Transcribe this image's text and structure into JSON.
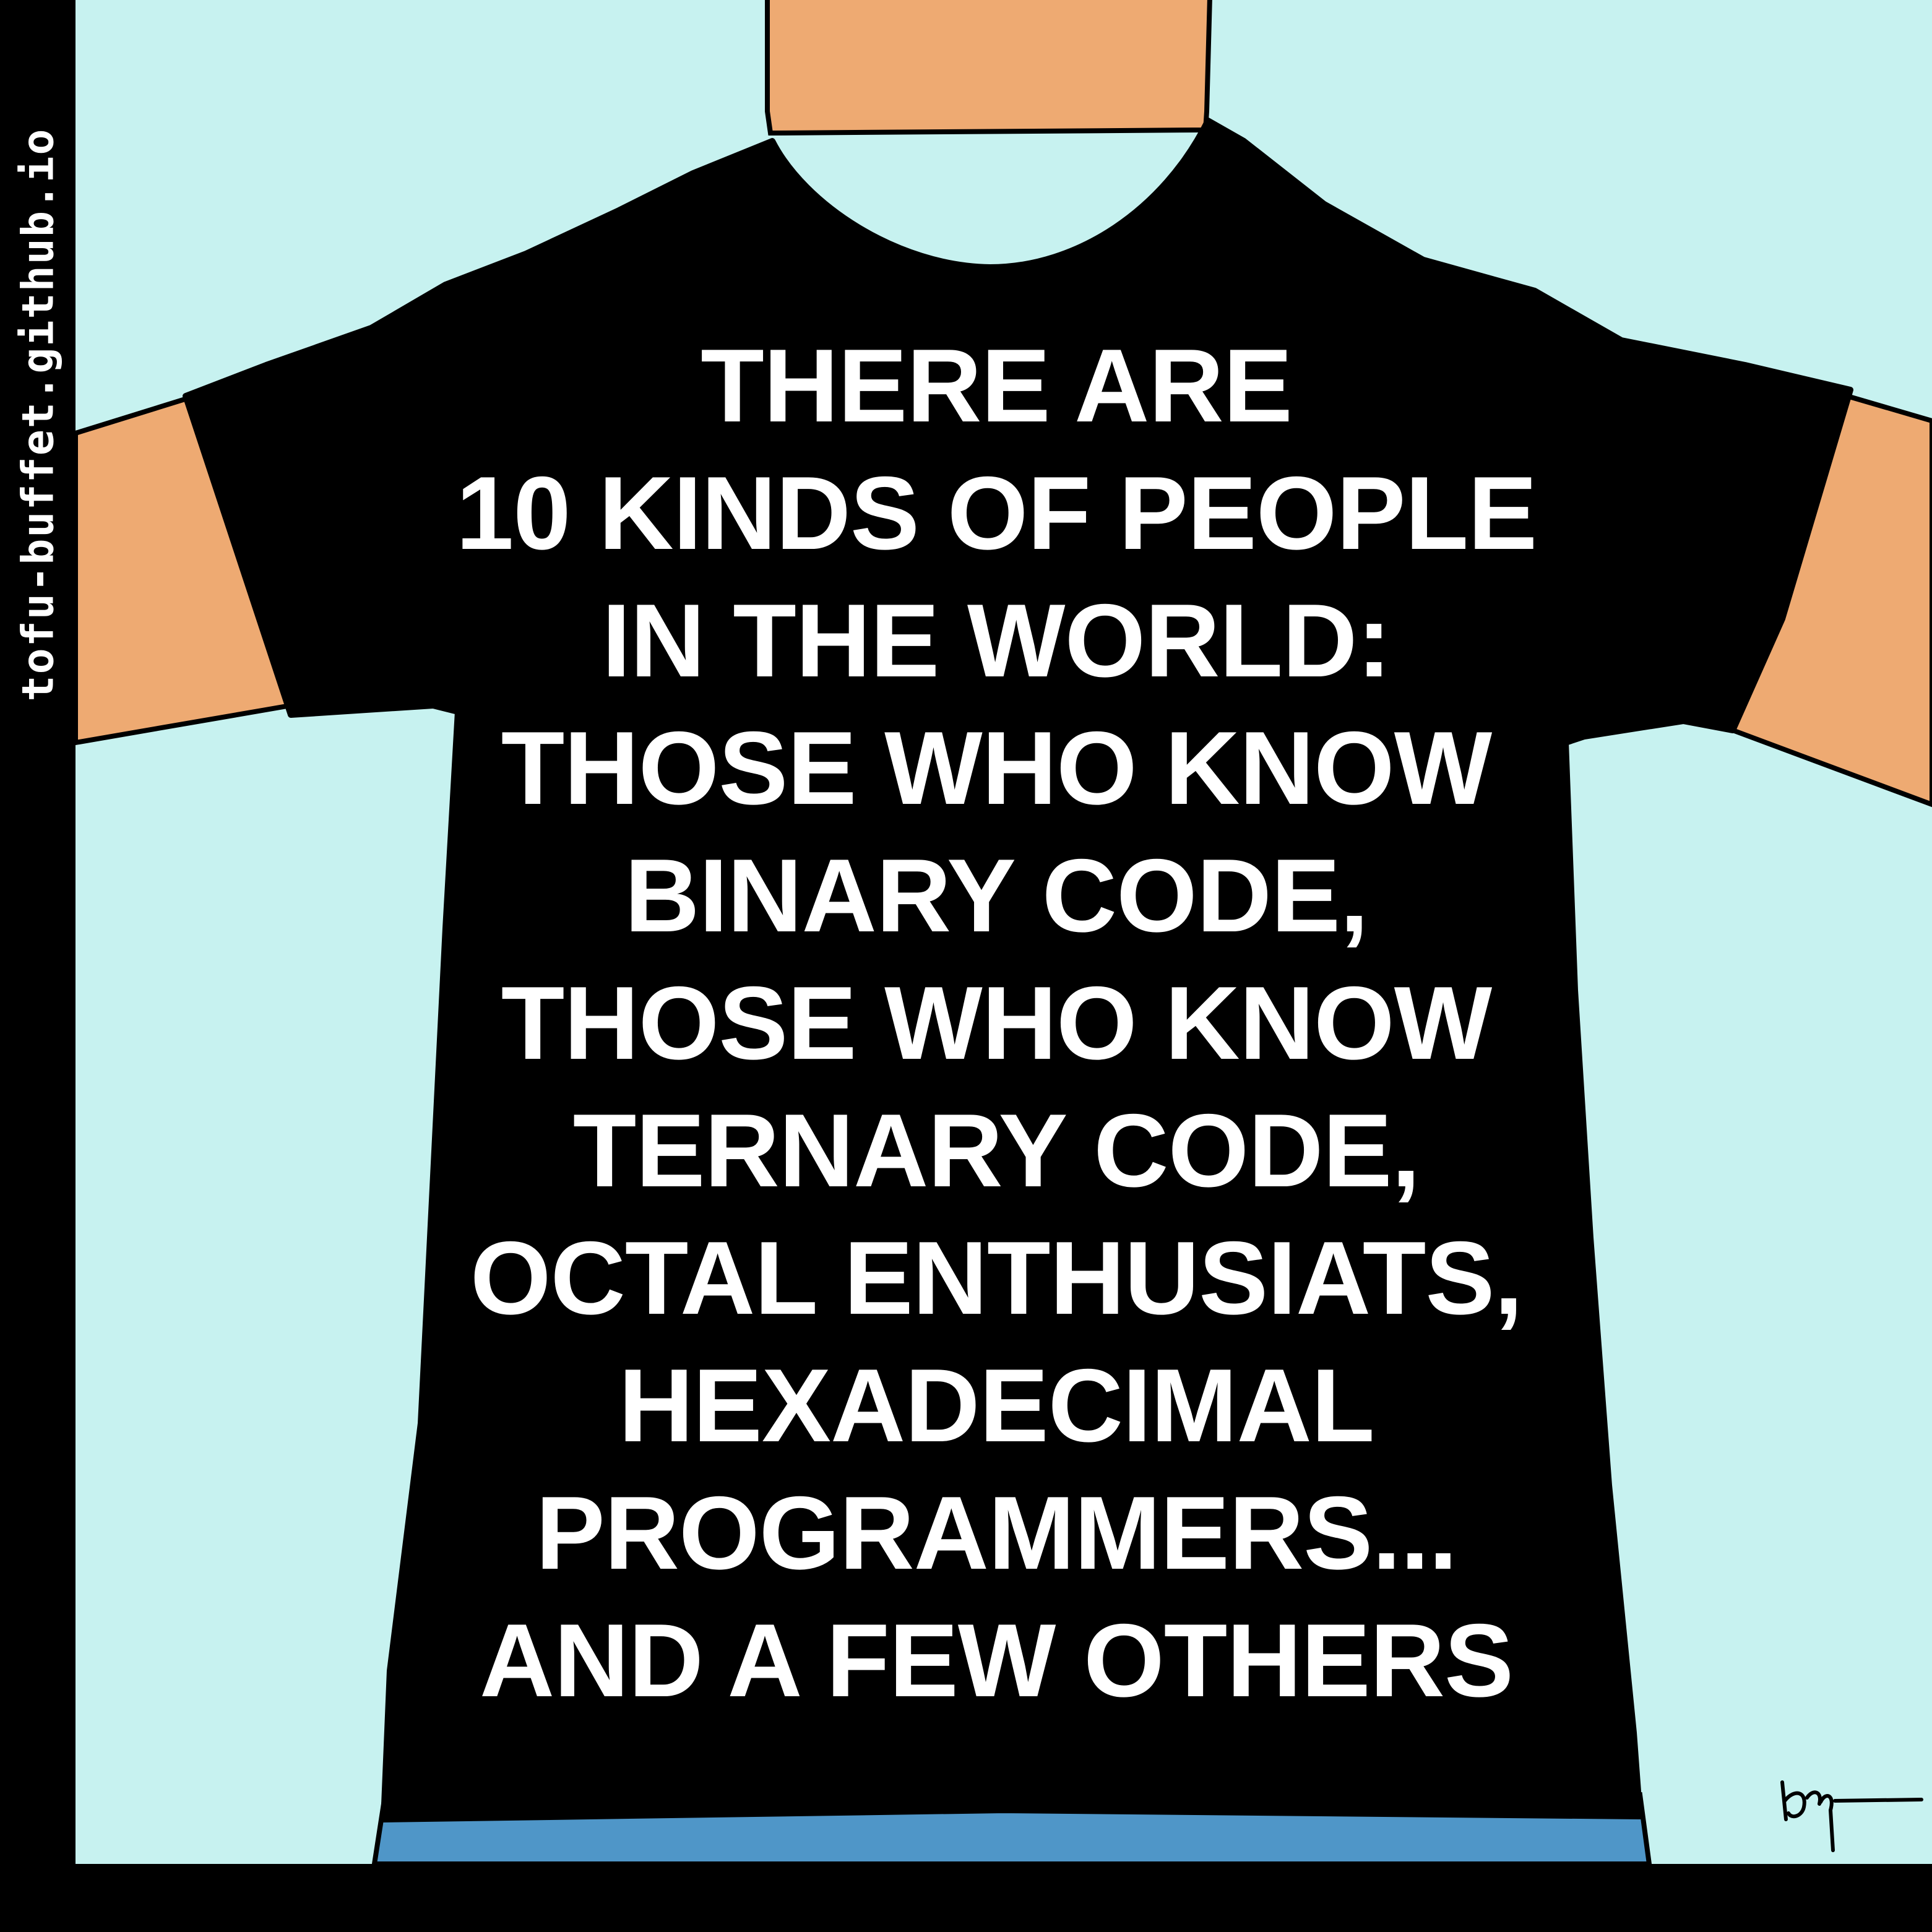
{
  "side_text": "tofu-buffet.github.io",
  "shirt_lines": [
    "THERE ARE",
    "10 KINDS OF PEOPLE",
    "IN THE WORLD:",
    "THOSE WHO KNOW",
    "BINARY CODE,",
    "THOSE WHO KNOW",
    "TERNARY CODE,",
    "OCTAL ENTHUSIATS,",
    "HEXADECIMAL",
    "PROGRAMMERS...",
    "AND A FEW OTHERS"
  ],
  "signature": "",
  "colors": {
    "background": "#c7f2f0",
    "frame": "#000000",
    "skin": "#eeaa72",
    "shirt": "#000000",
    "pants": "#4f96c8",
    "text": "#ffffff"
  }
}
